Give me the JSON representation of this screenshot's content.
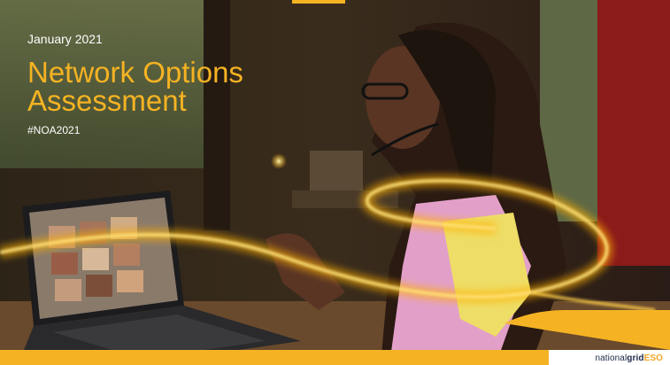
{
  "cover": {
    "date": "January 2021",
    "title_line1": "Network Options",
    "title_line2": "Assessment",
    "hashtag": "#NOA2021"
  },
  "logo": {
    "part1": "national",
    "part2": "grid",
    "part3": "ESO"
  },
  "colors": {
    "accent": "#f5b323",
    "brand_navy": "#1d2b49",
    "light_trail": "#ffcf4a"
  }
}
